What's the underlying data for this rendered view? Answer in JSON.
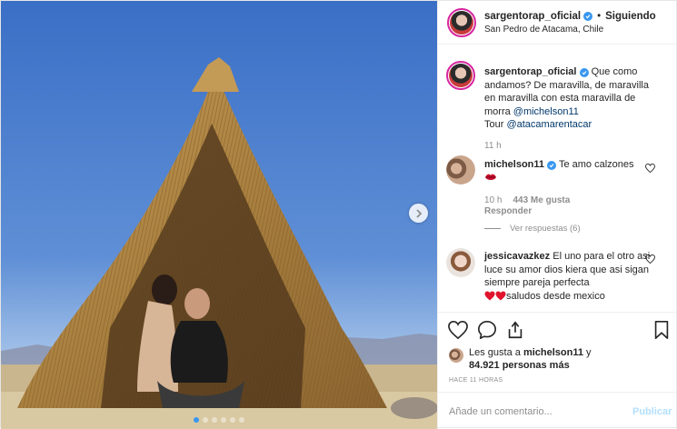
{
  "photo": {
    "alt": "",
    "carousel_index": 0,
    "carousel_count": 6,
    "colors": {
      "sky": "#3f74c9",
      "sky_horizon": "#b9d3ec",
      "straw": "#b58a4a",
      "straw_dark": "#5b3e1d",
      "ground": "#c8b58c"
    }
  },
  "post": {
    "username": "sargentorap_oficial",
    "separator": "•",
    "follow_status": "Siguiendo",
    "location": "San Pedro de Atacama, Chile"
  },
  "caption": {
    "username": "sargentorap_oficial",
    "text_before": "Que como andamos? De maravilla, de maravilla en maravilla con esta maravilla de morra ",
    "mention1": "@michelson11",
    "line2_prefix": "Tour ",
    "mention2": "@atacamarentacar",
    "time": "11 h"
  },
  "comments": [
    {
      "username": "michelson11",
      "verified": true,
      "text": "Te amo calzones",
      "time": "10 h",
      "likes": "443 Me gusta",
      "reply": "Responder",
      "view_replies": "Ver respuestas (6)"
    },
    {
      "username": "jessicavazkez",
      "verified": false,
      "text": "El uno para el otro asi luce su amor dios kiera que asi sigan siempre pareja perfecta ",
      "text_after": "saludos desde mexico"
    }
  ],
  "likes": {
    "prefix": "Les gusta a ",
    "user": "michelson11",
    "middle": " y",
    "count": "84.921 personas más"
  },
  "time_ago": "HACE 11 HORAS",
  "add_comment": {
    "placeholder": "Añade un comentario...",
    "publish_label": "Publicar"
  },
  "colors": {
    "verified": "#3897f0",
    "link": "#00376b",
    "muted": "#8e8e8e",
    "publish_disabled": "#b2dffc",
    "heart_red": "#ed4956"
  }
}
